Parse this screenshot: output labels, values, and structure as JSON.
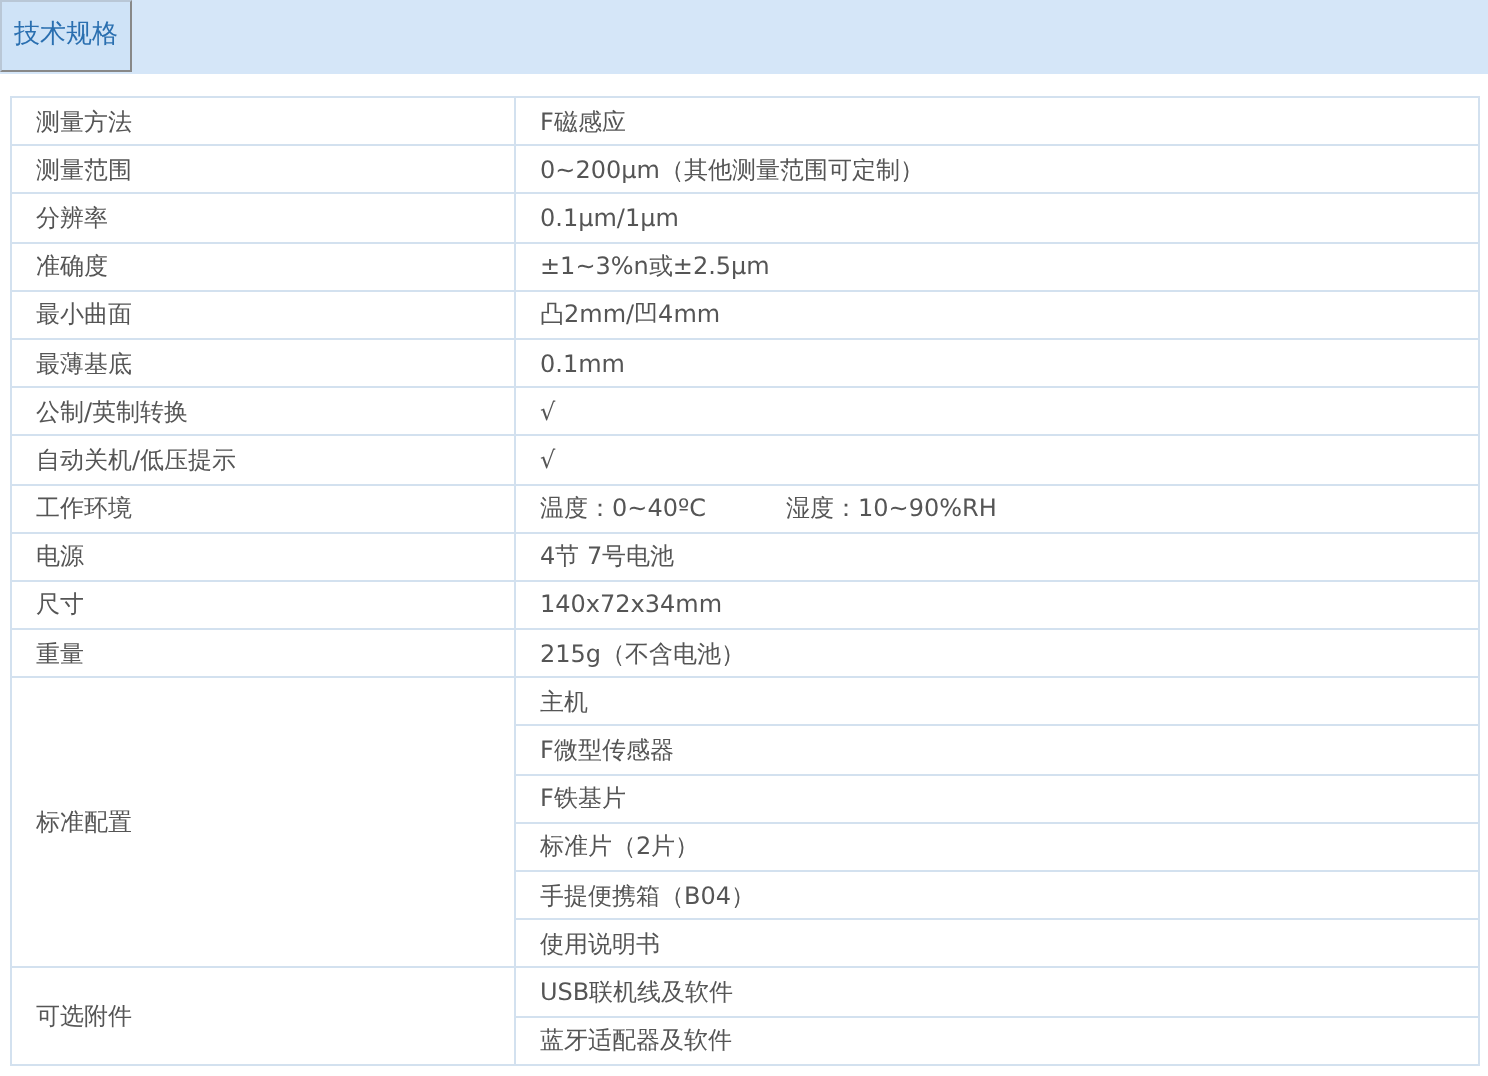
{
  "tabs": [
    {
      "label": "技术规格",
      "selected": true
    }
  ],
  "spec_table": {
    "rows": [
      {
        "label": "测量方法",
        "values": [
          [
            "F磁感应"
          ]
        ]
      },
      {
        "label": "测量范围",
        "values": [
          [
            "0~200μm（其他测量范围可定制）"
          ]
        ]
      },
      {
        "label": "分辨率",
        "values": [
          [
            "0.1μm/1μm"
          ]
        ]
      },
      {
        "label": "准确度",
        "values": [
          [
            "±1~3%n或±2.5μm"
          ]
        ]
      },
      {
        "label": "最小曲面",
        "values": [
          [
            "凸2mm/凹4mm"
          ]
        ]
      },
      {
        "label": "最薄基底",
        "values": [
          [
            "0.1mm"
          ]
        ]
      },
      {
        "label": "公制/英制转换",
        "values": [
          [
            "√"
          ]
        ]
      },
      {
        "label": "自动关机/低压提示",
        "values": [
          [
            "√"
          ]
        ]
      },
      {
        "label": "工作环境",
        "values": [
          [
            "温度：0~40ºC",
            "湿度：10~90%RH"
          ]
        ]
      },
      {
        "label": "电源",
        "values": [
          [
            "4节 7号电池"
          ]
        ]
      },
      {
        "label": "尺寸",
        "values": [
          [
            "140x72x34mm"
          ]
        ]
      },
      {
        "label": "重量",
        "values": [
          [
            "215g（不含电池）"
          ]
        ]
      },
      {
        "label": "标准配置",
        "values": [
          [
            "主机"
          ],
          [
            "F微型传感器"
          ],
          [
            "F铁基片"
          ],
          [
            "标准片（2片）"
          ],
          [
            "手提便携箱（B04）"
          ],
          [
            "使用说明书"
          ]
        ]
      },
      {
        "label": "可选附件",
        "values": [
          [
            "USB联机线及软件"
          ],
          [
            "蓝牙适配器及软件"
          ]
        ]
      }
    ]
  }
}
